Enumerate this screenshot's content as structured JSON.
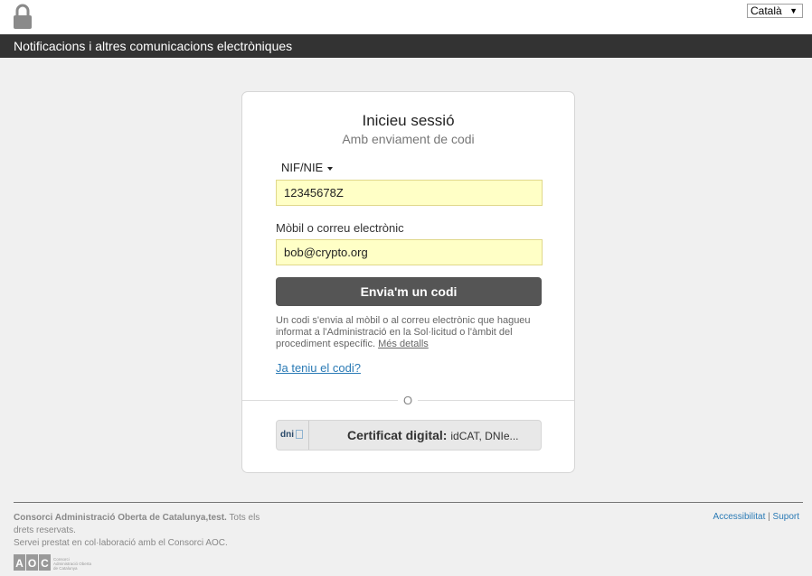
{
  "header": {
    "language": "Català"
  },
  "titlebar": {
    "title": "Notificacions i altres comunicacions electròniques"
  },
  "login": {
    "title": "Inicieu sessió",
    "subtitle": "Amb enviament de codi",
    "id_type": "NIF/NIE",
    "id_value": "12345678Z",
    "contact_label": "Mòbil o correu electrònic",
    "contact_value": "bob@crypto.org",
    "send_button": "Envia'm un codi",
    "help_text": "Un codi s'envia al mòbil o al correu electrònic que hagueu informat a l'Administració en la Sol·licitud o l'àmbit del procediment específic.",
    "more_link": "Més detalls",
    "have_code_link": "Ja teniu el codi?",
    "or_text": "O",
    "cert_icon_label": "dni",
    "cert_label": "Certificat digital:",
    "cert_sub": "idCAT, DNIe..."
  },
  "footer": {
    "org": "Consorci Administració Oberta de Catalunya,test.",
    "rights": "Tots els drets reservats.",
    "service": "Servei prestat en col·laboració amb el Consorci AOC.",
    "accessibility_link": "Accessibilitat",
    "separator": "|",
    "support_link": "Suport",
    "logo_letters": "AOC",
    "logo_text": "Consorci Administració Oberta de Catalunya"
  },
  "colors": {
    "titlebar": "#333333",
    "field_bg": "#ffffc6",
    "button_bg": "#555555",
    "link": "#2a7ab5"
  }
}
